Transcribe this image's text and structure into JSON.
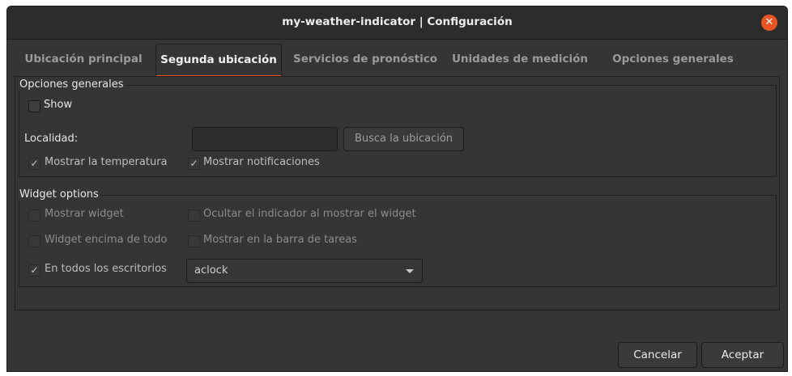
{
  "window": {
    "title": "my-weather-indicator | Configuración",
    "close_icon": "close-icon"
  },
  "tabs": [
    {
      "label": "Ubicación principal",
      "active": false
    },
    {
      "label": "Segunda ubicación",
      "active": true
    },
    {
      "label": "Servicios de pronóstico",
      "active": false
    },
    {
      "label": "Unidades de medición",
      "active": false
    },
    {
      "label": "Opciones generales",
      "active": false
    }
  ],
  "general": {
    "frame_label": "Opciones generales",
    "show": {
      "label": "Show",
      "checked": false
    },
    "locality_label": "Localidad:",
    "locality_value": "",
    "search_button": "Busca la ubicación",
    "show_temperature": {
      "label": "Mostrar la temperatura",
      "checked": true
    },
    "show_notifications": {
      "label": "Mostrar notificaciones",
      "checked": true
    }
  },
  "widget": {
    "frame_label": "Widget options",
    "show_widget": {
      "label": "Mostrar widget",
      "checked": false
    },
    "hide_indicator": {
      "label": "Ocultar el indicador al mostrar el widget",
      "checked": false
    },
    "widget_on_top": {
      "label": "Widget encima de todo",
      "checked": false
    },
    "show_taskbar": {
      "label": "Mostrar en la barra de tareas",
      "checked": false
    },
    "all_desktops": {
      "label": "En todos los escritorios",
      "checked": true
    },
    "theme_value": "aclock"
  },
  "footer": {
    "cancel": "Cancelar",
    "accept": "Aceptar"
  },
  "colors": {
    "accent": "#e95420",
    "background": "#353535"
  }
}
